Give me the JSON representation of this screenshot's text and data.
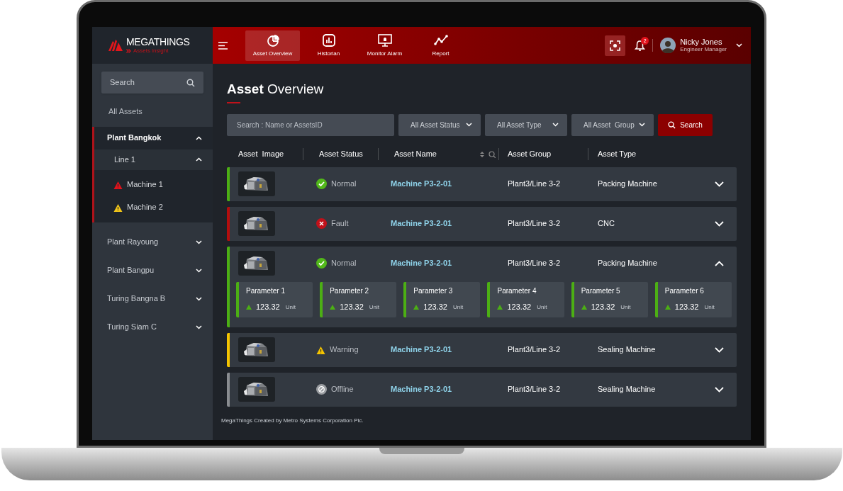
{
  "brand": {
    "name": "MEGATHINGS",
    "tagline": "Assets insight"
  },
  "nav": [
    {
      "label": "Asset Overview",
      "kind": "pie",
      "selected": true
    },
    {
      "label": "Historian",
      "kind": "bars",
      "selected": false
    },
    {
      "label": "Monitor Alarm",
      "kind": "monitor",
      "selected": false
    },
    {
      "label": "Report",
      "kind": "trend",
      "selected": false
    }
  ],
  "user": {
    "name": "Nicky Jones",
    "role": "Engineer Manager",
    "notifications": "2"
  },
  "sidebar": {
    "search": {
      "placeholder": "Search"
    },
    "all_assets": "All Assets",
    "tree": [
      {
        "label": "Plant Bangkok",
        "expanded": true,
        "children": [
          {
            "label": "Line 1",
            "expanded": true,
            "children": [
              {
                "label": "Machine 1",
                "color": "#e0121b"
              },
              {
                "label": "Machine 2",
                "color": "#f0c419"
              }
            ]
          }
        ]
      },
      {
        "label": "Plant Rayoung",
        "expanded": false
      },
      {
        "label": "Plant Bangpu",
        "expanded": false
      },
      {
        "label": "Turing Bangna B",
        "expanded": false
      },
      {
        "label": "Turing Siam C",
        "expanded": false
      }
    ]
  },
  "page": {
    "title_bold": "Asset",
    "title_rest": "Overview"
  },
  "filters": {
    "search": {
      "placeholder": "Search : Name or  AssetsID"
    },
    "dropdowns": [
      "All Asset Status",
      "All Asset Type",
      "All Asset  Group"
    ],
    "button": "Search"
  },
  "table": {
    "columns": [
      "Asset  Image",
      "Asset Status",
      "Asset Name",
      "Asset Group",
      "Asset Type"
    ],
    "rows": [
      {
        "status": {
          "kind": "normal",
          "label": "Normal"
        },
        "name": "Machine P3-2-01",
        "group": "Plant3/Line 3-2",
        "type": "Packing Machine",
        "expanded": false
      },
      {
        "status": {
          "kind": "fault",
          "label": "Fault"
        },
        "name": "Machine P3-2-01",
        "group": "Plant3/Line 3-2",
        "type": "CNC",
        "expanded": false
      },
      {
        "status": {
          "kind": "normal",
          "label": "Normal"
        },
        "name": "Machine P3-2-01",
        "group": "Plant3/Line 3-2",
        "type": "Packing Machine",
        "expanded": true,
        "parameters": [
          {
            "name": "Parameter 1",
            "value": "123.32",
            "unit": "Unit"
          },
          {
            "name": "Parameter 2",
            "value": "123.32",
            "unit": "Unit"
          },
          {
            "name": "Parameter 3",
            "value": "123.32",
            "unit": "Unit"
          },
          {
            "name": "Parameter 4",
            "value": "123.32",
            "unit": "Unit"
          },
          {
            "name": "Parameter 5",
            "value": "123.32",
            "unit": "Unit"
          },
          {
            "name": "Parameter 6",
            "value": "123.32",
            "unit": "Unit"
          }
        ]
      },
      {
        "status": {
          "kind": "warning",
          "label": "Warning"
        },
        "name": "Machine P3-2-01",
        "group": "Plant3/Line 3-2",
        "type": "Sealing Machine",
        "expanded": false
      },
      {
        "status": {
          "kind": "offline",
          "label": "Offline"
        },
        "name": "Machine P3-2-01",
        "group": "Plant3/Line 3-2",
        "type": "Sealing Machine",
        "expanded": false
      }
    ]
  },
  "footer": "MegaThings Created by Metro Systems Corporation Plc."
}
